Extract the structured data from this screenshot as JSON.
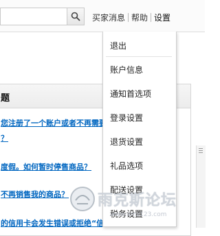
{
  "top_nav": {
    "items": [
      {
        "label": "买家消息"
      },
      {
        "label": "帮助"
      },
      {
        "label": "设置"
      }
    ]
  },
  "settings_menu": {
    "items": [
      {
        "label": "退出"
      },
      {
        "label": "账户信息"
      },
      {
        "label": "通知首选项"
      },
      {
        "label": "登录设置"
      },
      {
        "label": "退货设置"
      },
      {
        "label": "礼品选项"
      },
      {
        "label": "配送设置"
      },
      {
        "label": "税务设置"
      }
    ]
  },
  "content": {
    "header_title": "题",
    "question_links": [
      {
        "text": "您注册了一个账户或者不再需要"
      },
      {
        "text": "？"
      },
      {
        "text": "度假。如何暂时停售商品？"
      },
      {
        "text": "不再销售我的商品？"
      },
      {
        "text": "的信用卡会发生错误或拒绝“信"
      }
    ]
  },
  "watermark": {
    "text": "雨克斯论坛",
    "url": "www.amz123.com"
  },
  "colors": {
    "link": "#0066c0",
    "topbar_bg": "#fbfbfb",
    "menu_border": "#cfcfcf"
  }
}
